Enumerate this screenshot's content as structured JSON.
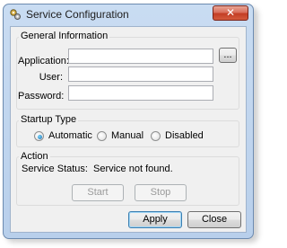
{
  "window": {
    "title": "Service Configuration",
    "close_label": "✕",
    "app_icon": "gears-icon"
  },
  "general_info": {
    "title": "General Information",
    "application_label": "Application:",
    "application_value": "",
    "browse_label": "...",
    "user_label": "User:",
    "user_value": "",
    "password_label": "Password:",
    "password_value": ""
  },
  "startup_type": {
    "title": "Startup Type",
    "selected": "Automatic",
    "options": [
      "Automatic",
      "Manual",
      "Disabled"
    ]
  },
  "action": {
    "title": "Action",
    "status_label": "Service Status:",
    "status_value": "Service not found.",
    "start_label": "Start",
    "stop_label": "Stop"
  },
  "footer": {
    "apply_label": "Apply",
    "close_label": "Close"
  },
  "colors": {
    "title_bar": "#c9dcf2",
    "close_button": "#c33e25",
    "dialog_bg": "#f0f0f0",
    "radio_selected": "#1c6fb1"
  }
}
